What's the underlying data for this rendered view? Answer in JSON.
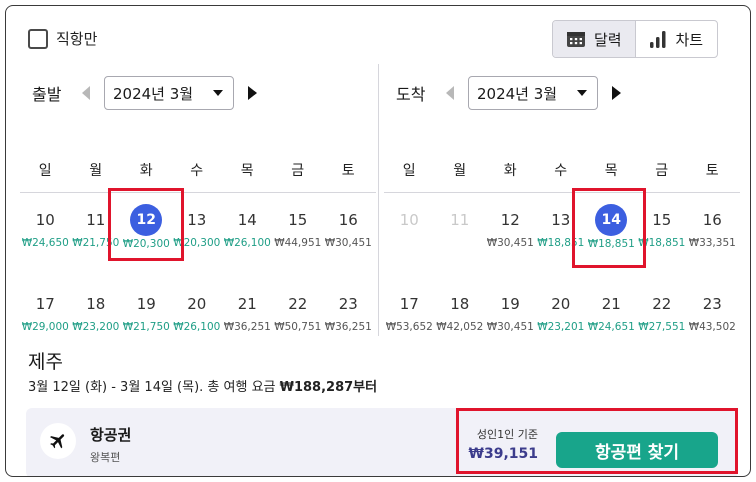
{
  "top": {
    "direct_only_label": "직항만",
    "view_toggle": {
      "calendar_label": "달력",
      "chart_label": "차트",
      "active": "calendar"
    }
  },
  "departure": {
    "label": "출발",
    "month": "2024년 3월",
    "weekdays": [
      "일",
      "월",
      "화",
      "수",
      "목",
      "금",
      "토"
    ],
    "weeks": [
      [
        {
          "day": "10",
          "price": "₩24,650",
          "tone": "green"
        },
        {
          "day": "11",
          "price": "₩21,750",
          "tone": "green"
        },
        {
          "day": "12",
          "price": "₩20,300",
          "tone": "green",
          "selected": true
        },
        {
          "day": "13",
          "price": "₩20,300",
          "tone": "green"
        },
        {
          "day": "14",
          "price": "₩26,100",
          "tone": "green"
        },
        {
          "day": "15",
          "price": "₩44,951",
          "tone": "gray"
        },
        {
          "day": "16",
          "price": "₩30,451",
          "tone": "gray"
        }
      ],
      [
        {
          "day": "17",
          "price": "₩29,000",
          "tone": "green"
        },
        {
          "day": "18",
          "price": "₩23,200",
          "tone": "green"
        },
        {
          "day": "19",
          "price": "₩21,750",
          "tone": "green"
        },
        {
          "day": "20",
          "price": "₩26,100",
          "tone": "green"
        },
        {
          "day": "21",
          "price": "₩36,251",
          "tone": "gray"
        },
        {
          "day": "22",
          "price": "₩50,751",
          "tone": "gray"
        },
        {
          "day": "23",
          "price": "₩36,251",
          "tone": "gray"
        }
      ]
    ]
  },
  "arrival": {
    "label": "도착",
    "month": "2024년 3월",
    "weekdays": [
      "일",
      "월",
      "화",
      "수",
      "목",
      "금",
      "토"
    ],
    "weeks": [
      [
        {
          "day": "10",
          "price": "",
          "disabled": true
        },
        {
          "day": "11",
          "price": "",
          "disabled": true
        },
        {
          "day": "12",
          "price": "₩30,451",
          "tone": "gray"
        },
        {
          "day": "13",
          "price": "₩18,851",
          "tone": "green"
        },
        {
          "day": "14",
          "price": "₩18,851",
          "tone": "green",
          "selected": true
        },
        {
          "day": "15",
          "price": "₩18,851",
          "tone": "green"
        },
        {
          "day": "16",
          "price": "₩33,351",
          "tone": "gray"
        }
      ],
      [
        {
          "day": "17",
          "price": "₩53,652",
          "tone": "gray"
        },
        {
          "day": "18",
          "price": "₩42,052",
          "tone": "gray"
        },
        {
          "day": "19",
          "price": "₩30,451",
          "tone": "gray"
        },
        {
          "day": "20",
          "price": "₩23,201",
          "tone": "green"
        },
        {
          "day": "21",
          "price": "₩24,651",
          "tone": "green"
        },
        {
          "day": "22",
          "price": "₩27,551",
          "tone": "green"
        },
        {
          "day": "23",
          "price": "₩43,502",
          "tone": "gray"
        }
      ]
    ]
  },
  "summary": {
    "destination": "제주",
    "text": "3월 12일 (화) - 3월 14일 (목). 총 여행 요금 ",
    "total": "₩188,287부터"
  },
  "flight": {
    "title": "항공권",
    "subtitle": "왕복편",
    "price_note": "성인1인 기준",
    "price": "₩39,151",
    "button_label": "항공편 찾기"
  },
  "colors": {
    "accent_blue": "#3c5fe0",
    "price_green": "#1f9e86",
    "button_green": "#18a58b",
    "highlight_red": "#e0142c"
  }
}
